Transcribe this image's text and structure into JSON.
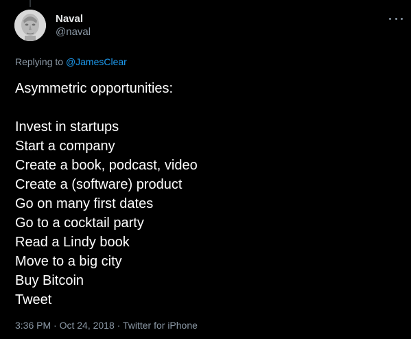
{
  "author": {
    "display_name": "Naval",
    "handle": "@naval",
    "avatar": "stone-bust-avatar"
  },
  "reply": {
    "prefix": "Replying to ",
    "mention": "@JamesClear"
  },
  "tweet": {
    "heading": "Asymmetric opportunities:",
    "items": [
      "Invest in startups",
      "Start a company",
      "Create a book, podcast, video",
      "Create a (software) product",
      "Go on many first dates",
      "Go to a cocktail party",
      "Read a Lindy book",
      "Move to a big city",
      "Buy Bitcoin",
      "Tweet"
    ]
  },
  "meta": {
    "time": "3:36 PM",
    "separator": " · ",
    "date": "Oct 24, 2018",
    "source": "Twitter for iPhone"
  },
  "icons": {
    "more": "more-options-icon"
  },
  "colors": {
    "background": "#000000",
    "text": "#ffffff",
    "secondary": "#8b98a5",
    "link": "#1d9bf0"
  }
}
